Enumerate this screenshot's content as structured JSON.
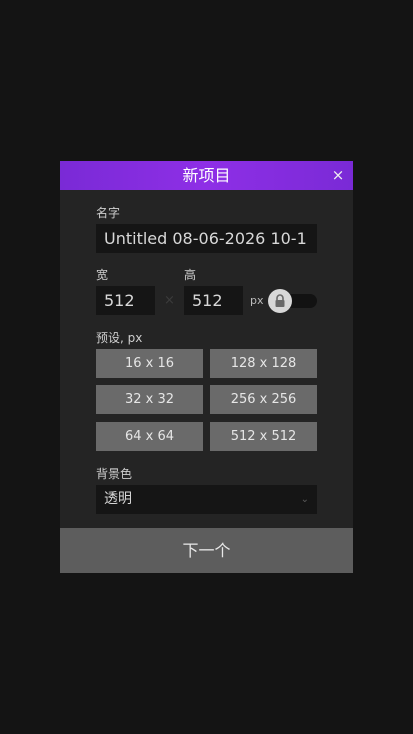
{
  "dialog": {
    "title": "新项目",
    "close_glyph": "×",
    "name_label": "名字",
    "name_value": "Untitled 08-06-2026 10-1",
    "width_label": "宽",
    "height_label": "高",
    "width_value": "512",
    "height_value": "512",
    "times_glyph": "×",
    "unit_label": "px",
    "aspect_lock_icon": "lock-icon",
    "presets_label": "预设, px",
    "presets": [
      "16 x 16",
      "128 x 128",
      "32 x 32",
      "256 x 256",
      "64 x 64",
      "512 x 512"
    ],
    "background_label": "背景色",
    "background_value": "透明",
    "chevron_glyph": "⌄",
    "next_label": "下一个"
  },
  "colors": {
    "accent": "#8e2fe6",
    "panel": "#242424",
    "page": "#141414",
    "preset": "#6a6a6a",
    "footer_button": "#5d5d5d"
  }
}
